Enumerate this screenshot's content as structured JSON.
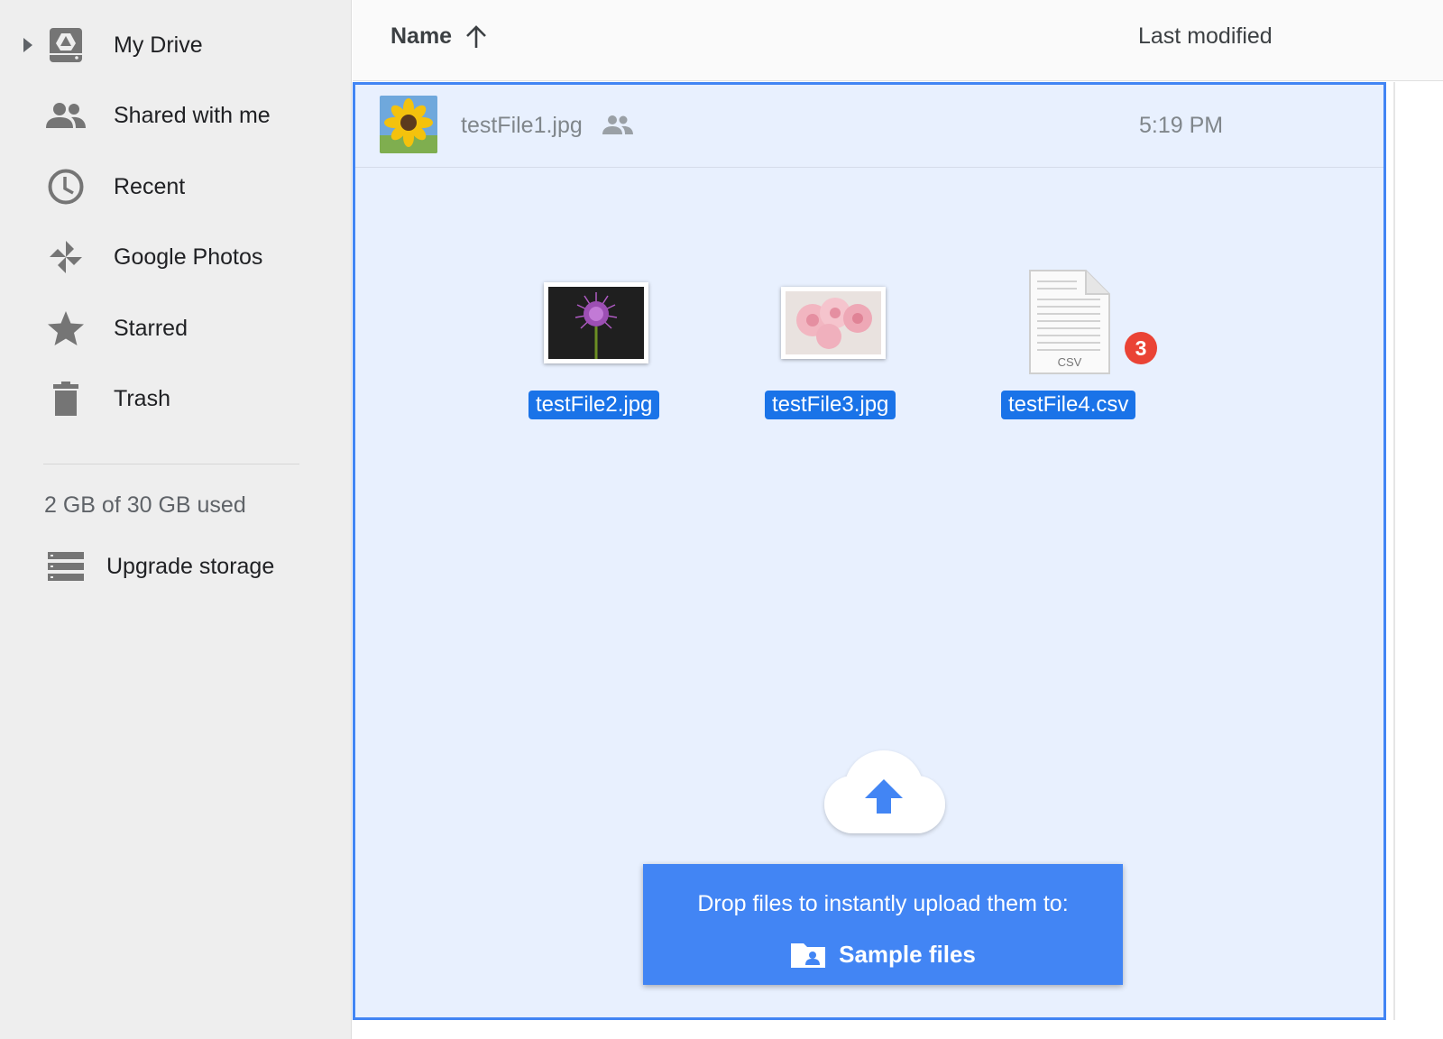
{
  "sidebar": {
    "items": [
      {
        "label": "My Drive",
        "icon": "drive-icon"
      },
      {
        "label": "Shared with me",
        "icon": "people-icon"
      },
      {
        "label": "Recent",
        "icon": "clock-icon"
      },
      {
        "label": "Google Photos",
        "icon": "pinwheel-icon"
      },
      {
        "label": "Starred",
        "icon": "star-icon"
      },
      {
        "label": "Trash",
        "icon": "trash-icon"
      }
    ],
    "storage_text": "2 GB of 30 GB used",
    "upgrade_label": "Upgrade storage"
  },
  "list_header": {
    "name_label": "Name",
    "modified_label": "Last modified"
  },
  "files": [
    {
      "name": "testFile1.jpg",
      "modified": "5:19 PM",
      "shared": true
    }
  ],
  "drag": {
    "items": [
      {
        "name": "testFile2.jpg",
        "icon": "purple-flower-thumbnail"
      },
      {
        "name": "testFile3.jpg",
        "icon": "pink-flowers-thumbnail"
      },
      {
        "name": "testFile4.csv",
        "icon": "csv-file-icon",
        "file_type": "CSV"
      }
    ],
    "count": "3"
  },
  "upload": {
    "message": "Drop files to instantly upload them to:",
    "target": "Sample files"
  },
  "colors": {
    "accent": "#4285f4",
    "selection": "#1a73e8",
    "dropzone_bg": "#e8f0fe",
    "badge": "#ea4335"
  }
}
